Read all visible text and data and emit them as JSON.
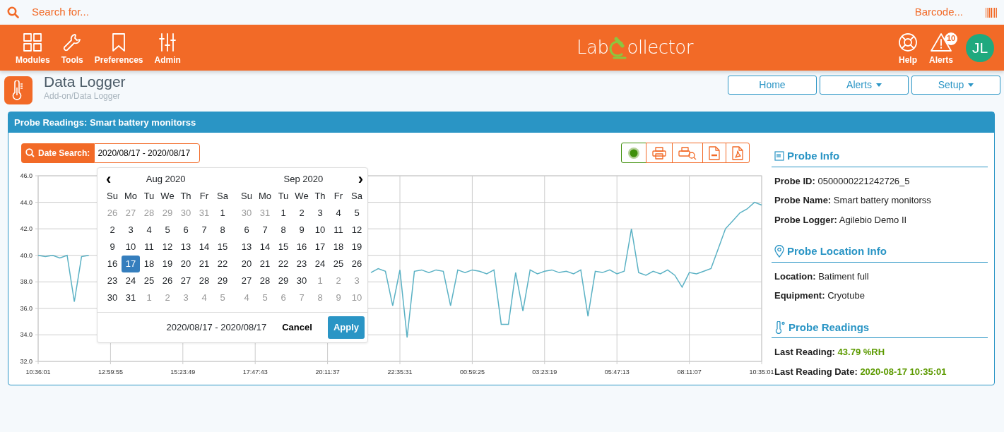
{
  "search": {
    "placeholder": "Search for...",
    "barcode": "Barcode..."
  },
  "nav": {
    "left": [
      {
        "kind": "modules",
        "label": "Modules"
      },
      {
        "kind": "tools",
        "label": "Tools"
      },
      {
        "kind": "preferences",
        "label": "Preferences"
      },
      {
        "kind": "admin",
        "label": "Admin"
      }
    ],
    "logo": [
      "Lab",
      "ollector"
    ],
    "right": [
      {
        "kind": "help",
        "label": "Help"
      },
      {
        "kind": "alerts",
        "label": "Alerts",
        "badge": "10"
      }
    ],
    "avatar": "JL"
  },
  "page": {
    "title": "Data Logger",
    "breadcrumb": "Add-on/Data Logger",
    "buttons": [
      {
        "label": "Home",
        "dropdown": false
      },
      {
        "label": "Alerts",
        "dropdown": true
      },
      {
        "label": "Setup",
        "dropdown": true
      }
    ]
  },
  "panel": {
    "title": "Probe Readings: Smart battery monitorss",
    "date_search": {
      "label": "Date Search:",
      "value": "2020/08/17 - 2020/08/17"
    },
    "toolbar": [
      {
        "kind": "status",
        "color": "#3f8f0a"
      },
      {
        "kind": "print"
      },
      {
        "kind": "preview"
      },
      {
        "kind": "csv"
      },
      {
        "kind": "pdf"
      }
    ],
    "chart_data": {
      "type": "line",
      "categories": [
        "10:36:01",
        null,
        null,
        null,
        null,
        null,
        null,
        null,
        null,
        null,
        "12:59:55",
        null,
        null,
        null,
        null,
        null,
        null,
        null,
        null,
        null,
        "15:23:49",
        null,
        null,
        null,
        null,
        null,
        null,
        null,
        null,
        null,
        "17:47:43",
        null,
        null,
        null,
        null,
        null,
        null,
        null,
        null,
        null,
        "20:11:37",
        null,
        null,
        null,
        null,
        null,
        null,
        null,
        null,
        null,
        "22:35:31",
        null,
        null,
        null,
        null,
        null,
        null,
        null,
        null,
        null,
        "00:59:25",
        null,
        null,
        null,
        null,
        null,
        null,
        null,
        null,
        null,
        "03:23:19",
        null,
        null,
        null,
        null,
        null,
        null,
        null,
        null,
        null,
        "05:47:13",
        null,
        null,
        null,
        null,
        null,
        null,
        null,
        null,
        null,
        "08:11:07",
        null,
        null,
        null,
        null,
        null,
        null,
        null,
        null,
        null,
        "10:35:01"
      ],
      "series": [
        {
          "color": "#5ab1c4",
          "values": [
            40.0,
            39.9,
            40.0,
            39.8,
            40.0,
            36.5,
            39.9,
            40.0,
            null,
            null,
            null,
            null,
            null,
            null,
            null,
            null,
            null,
            null,
            null,
            null,
            null,
            null,
            null,
            null,
            null,
            null,
            null,
            null,
            null,
            null,
            null,
            null,
            null,
            null,
            null,
            null,
            null,
            null,
            null,
            null,
            null,
            null,
            null,
            null,
            null,
            null,
            38.7,
            39.0,
            38.8,
            36.2,
            38.9,
            33.8,
            38.8,
            38.9,
            38.7,
            38.9,
            38.8,
            36.2,
            38.9,
            38.7,
            38.9,
            38.8,
            38.6,
            38.9,
            34.8,
            34.8,
            38.7,
            35.8,
            38.9,
            38.6,
            38.8,
            38.9,
            38.7,
            38.8,
            38.6,
            38.9,
            35.4,
            38.8,
            38.7,
            38.9,
            38.6,
            38.8,
            42.0,
            38.7,
            38.5,
            38.8,
            38.6,
            38.9,
            38.5,
            37.6,
            38.7,
            38.6,
            38.8,
            39.0,
            40.5,
            42.0,
            42.6,
            43.2,
            43.5,
            44.0,
            43.79
          ]
        }
      ],
      "ylim": [
        32,
        46
      ],
      "grid": true,
      "yticks": [
        {
          "value": 32,
          "label": "32.0"
        },
        {
          "value": 34,
          "label": "34.0"
        },
        {
          "value": 36,
          "label": "36.0"
        },
        {
          "value": 38,
          "label": "38.0"
        },
        {
          "value": 40,
          "label": "40.0"
        },
        {
          "value": 42,
          "label": "42.0"
        },
        {
          "value": 44,
          "label": "44.0"
        },
        {
          "value": 46,
          "label": "46.0"
        }
      ]
    },
    "calendar": {
      "prev": "‹",
      "next": "›",
      "months": [
        {
          "title": "Aug 2020",
          "weekdays": [
            "Su",
            "Mo",
            "Tu",
            "We",
            "Th",
            "Fr",
            "Sa"
          ],
          "weeks": [
            [
              {
                "d": "26",
                "muted": true,
                "selected": false
              },
              {
                "d": "27",
                "muted": true,
                "selected": false
              },
              {
                "d": "28",
                "muted": true,
                "selected": false
              },
              {
                "d": "29",
                "muted": true,
                "selected": false
              },
              {
                "d": "30",
                "muted": true,
                "selected": false
              },
              {
                "d": "31",
                "muted": true,
                "selected": false
              },
              {
                "d": "1",
                "muted": false,
                "selected": false
              }
            ],
            [
              {
                "d": "2",
                "muted": false,
                "selected": false
              },
              {
                "d": "3",
                "muted": false,
                "selected": false
              },
              {
                "d": "4",
                "muted": false,
                "selected": false
              },
              {
                "d": "5",
                "muted": false,
                "selected": false
              },
              {
                "d": "6",
                "muted": false,
                "selected": false
              },
              {
                "d": "7",
                "muted": false,
                "selected": false
              },
              {
                "d": "8",
                "muted": false,
                "selected": false
              }
            ],
            [
              {
                "d": "9",
                "muted": false,
                "selected": false
              },
              {
                "d": "10",
                "muted": false,
                "selected": false
              },
              {
                "d": "11",
                "muted": false,
                "selected": false
              },
              {
                "d": "12",
                "muted": false,
                "selected": false
              },
              {
                "d": "13",
                "muted": false,
                "selected": false
              },
              {
                "d": "14",
                "muted": false,
                "selected": false
              },
              {
                "d": "15",
                "muted": false,
                "selected": false
              }
            ],
            [
              {
                "d": "16",
                "muted": false,
                "selected": false
              },
              {
                "d": "17",
                "muted": false,
                "selected": true
              },
              {
                "d": "18",
                "muted": false,
                "selected": false
              },
              {
                "d": "19",
                "muted": false,
                "selected": false
              },
              {
                "d": "20",
                "muted": false,
                "selected": false
              },
              {
                "d": "21",
                "muted": false,
                "selected": false
              },
              {
                "d": "22",
                "muted": false,
                "selected": false
              }
            ],
            [
              {
                "d": "23",
                "muted": false,
                "selected": false
              },
              {
                "d": "24",
                "muted": false,
                "selected": false
              },
              {
                "d": "25",
                "muted": false,
                "selected": false
              },
              {
                "d": "26",
                "muted": false,
                "selected": false
              },
              {
                "d": "27",
                "muted": false,
                "selected": false
              },
              {
                "d": "28",
                "muted": false,
                "selected": false
              },
              {
                "d": "29",
                "muted": false,
                "selected": false
              }
            ],
            [
              {
                "d": "30",
                "muted": false,
                "selected": false
              },
              {
                "d": "31",
                "muted": false,
                "selected": false
              },
              {
                "d": "1",
                "muted": true,
                "selected": false
              },
              {
                "d": "2",
                "muted": true,
                "selected": false
              },
              {
                "d": "3",
                "muted": true,
                "selected": false
              },
              {
                "d": "4",
                "muted": true,
                "selected": false
              },
              {
                "d": "5",
                "muted": true,
                "selected": false
              }
            ]
          ]
        },
        {
          "title": "Sep 2020",
          "weekdays": [
            "Su",
            "Mo",
            "Tu",
            "We",
            "Th",
            "Fr",
            "Sa"
          ],
          "weeks": [
            [
              {
                "d": "30",
                "muted": true,
                "selected": false
              },
              {
                "d": "31",
                "muted": true,
                "selected": false
              },
              {
                "d": "1",
                "muted": false,
                "selected": false
              },
              {
                "d": "2",
                "muted": false,
                "selected": false
              },
              {
                "d": "3",
                "muted": false,
                "selected": false
              },
              {
                "d": "4",
                "muted": false,
                "selected": false
              },
              {
                "d": "5",
                "muted": false,
                "selected": false
              }
            ],
            [
              {
                "d": "6",
                "muted": false,
                "selected": false
              },
              {
                "d": "7",
                "muted": false,
                "selected": false
              },
              {
                "d": "8",
                "muted": false,
                "selected": false
              },
              {
                "d": "9",
                "muted": false,
                "selected": false
              },
              {
                "d": "10",
                "muted": false,
                "selected": false
              },
              {
                "d": "11",
                "muted": false,
                "selected": false
              },
              {
                "d": "12",
                "muted": false,
                "selected": false
              }
            ],
            [
              {
                "d": "13",
                "muted": false,
                "selected": false
              },
              {
                "d": "14",
                "muted": false,
                "selected": false
              },
              {
                "d": "15",
                "muted": false,
                "selected": false
              },
              {
                "d": "16",
                "muted": false,
                "selected": false
              },
              {
                "d": "17",
                "muted": false,
                "selected": false
              },
              {
                "d": "18",
                "muted": false,
                "selected": false
              },
              {
                "d": "19",
                "muted": false,
                "selected": false
              }
            ],
            [
              {
                "d": "20",
                "muted": false,
                "selected": false
              },
              {
                "d": "21",
                "muted": false,
                "selected": false
              },
              {
                "d": "22",
                "muted": false,
                "selected": false
              },
              {
                "d": "23",
                "muted": false,
                "selected": false
              },
              {
                "d": "24",
                "muted": false,
                "selected": false
              },
              {
                "d": "25",
                "muted": false,
                "selected": false
              },
              {
                "d": "26",
                "muted": false,
                "selected": false
              }
            ],
            [
              {
                "d": "27",
                "muted": false,
                "selected": false
              },
              {
                "d": "28",
                "muted": false,
                "selected": false
              },
              {
                "d": "29",
                "muted": false,
                "selected": false
              },
              {
                "d": "30",
                "muted": false,
                "selected": false
              },
              {
                "d": "1",
                "muted": true,
                "selected": false
              },
              {
                "d": "2",
                "muted": true,
                "selected": false
              },
              {
                "d": "3",
                "muted": true,
                "selected": false
              }
            ],
            [
              {
                "d": "4",
                "muted": true,
                "selected": false
              },
              {
                "d": "5",
                "muted": true,
                "selected": false
              },
              {
                "d": "6",
                "muted": true,
                "selected": false
              },
              {
                "d": "7",
                "muted": true,
                "selected": false
              },
              {
                "d": "8",
                "muted": true,
                "selected": false
              },
              {
                "d": "9",
                "muted": true,
                "selected": false
              },
              {
                "d": "10",
                "muted": true,
                "selected": false
              }
            ]
          ]
        }
      ],
      "range": "2020/08/17 - 2020/08/17",
      "cancel": "Cancel",
      "apply": "Apply"
    },
    "info": [
      {
        "kind": "info",
        "title": "Probe Info",
        "fields": [
          {
            "label": "Probe ID:",
            "value": "0500000221242726_5",
            "highlight": false
          },
          {
            "label": "Probe Name:",
            "value": "Smart battery monitorss",
            "highlight": false
          },
          {
            "label": "Probe Logger:",
            "value": "Agilebio Demo II",
            "highlight": false
          }
        ]
      },
      {
        "kind": "location",
        "title": "Probe Location Info",
        "fields": [
          {
            "label": "Location:",
            "value": "Batiment full",
            "highlight": false
          },
          {
            "label": "Equipment:",
            "value": "Cryotube",
            "highlight": false
          }
        ]
      },
      {
        "kind": "readings",
        "title": "Probe Readings",
        "fields": [
          {
            "label": "Last Reading:",
            "value": "43.79 %RH",
            "highlight": true
          },
          {
            "label": "Last Reading Date:",
            "value": "2020-08-17 10:35:01",
            "highlight": true
          }
        ]
      }
    ]
  }
}
